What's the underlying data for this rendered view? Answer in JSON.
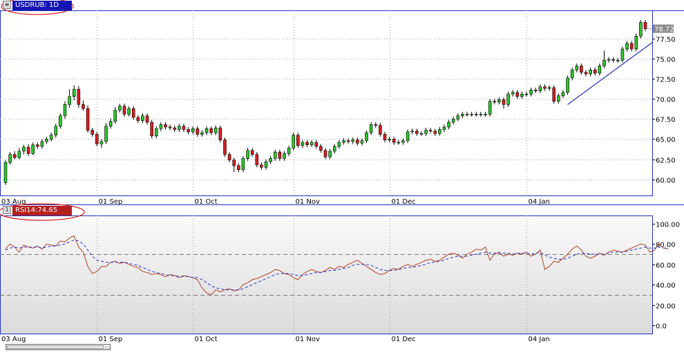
{
  "price_tag": "USDRUB: 1D",
  "rsi_tag": "RSI14:74.65",
  "last_price_label": "78.72",
  "price_y_ticks": [
    "60.00",
    "62.50",
    "65.00",
    "67.50",
    "70.00",
    "72.50",
    "75.00",
    "77.50"
  ],
  "rsi_y_ticks": [
    "0.0",
    "20.00",
    "40.00",
    "60.00",
    "80.00",
    "100.00"
  ],
  "x_ticks": [
    "03 Aug",
    "01 Sep",
    "01 Oct",
    "01 Nov",
    "01 Dec",
    "04 Jan"
  ],
  "colors": {
    "pane_border": "#1a2fbf",
    "grid": "#9a9a9a",
    "bull": "#2ec42e",
    "bear": "#d81e1e",
    "trendline": "#1a2fbf",
    "rsi": "#b04020",
    "rsi_avg": "#2233cc",
    "tag_price": "#1414b4",
    "tag_rsi": "#b42020",
    "last_price_bg": "#8a8a8a"
  },
  "chart_data": [
    {
      "type": "candlestick",
      "title": "USDRUB: 1D",
      "ylim": [
        58.0,
        81.0
      ],
      "x_tick_labels": [
        "03 Aug",
        "01 Sep",
        "01 Oct",
        "01 Nov",
        "01 Dec",
        "04 Jan"
      ],
      "last_value": 78.72,
      "candles": [
        [
          59.6,
          62.1,
          59.3,
          62.4
        ],
        [
          62.1,
          63.1,
          61.8,
          63.4
        ],
        [
          63.1,
          62.7,
          62.5,
          63.5
        ],
        [
          62.7,
          63.5,
          62.5,
          63.9
        ],
        [
          63.5,
          64.0,
          63.1,
          64.3
        ],
        [
          64.0,
          63.2,
          62.9,
          64.4
        ],
        [
          63.2,
          64.3,
          63.0,
          64.6
        ],
        [
          64.3,
          64.1,
          63.8,
          64.6
        ],
        [
          64.1,
          64.7,
          63.8,
          65.0
        ],
        [
          64.7,
          65.0,
          64.4,
          65.3
        ],
        [
          65.0,
          65.5,
          64.7,
          65.8
        ],
        [
          65.5,
          66.6,
          65.2,
          66.9
        ],
        [
          66.6,
          67.9,
          66.3,
          68.2
        ],
        [
          67.9,
          69.3,
          67.5,
          69.7
        ],
        [
          69.3,
          70.3,
          68.9,
          71.2
        ],
        [
          70.3,
          71.2,
          69.8,
          71.7
        ],
        [
          71.2,
          69.3,
          68.9,
          71.6
        ],
        [
          69.3,
          68.8,
          68.5,
          69.8
        ],
        [
          68.8,
          66.1,
          65.8,
          69.2
        ],
        [
          66.1,
          65.6,
          65.3,
          66.4
        ],
        [
          65.6,
          64.4,
          64.1,
          65.9
        ],
        [
          64.4,
          64.7,
          63.9,
          65.0
        ],
        [
          64.7,
          66.6,
          64.4,
          67.0
        ],
        [
          66.6,
          67.2,
          66.3,
          67.6
        ],
        [
          67.2,
          68.6,
          66.9,
          69.0
        ],
        [
          68.6,
          69.1,
          68.3,
          69.4
        ],
        [
          69.1,
          68.1,
          67.8,
          69.4
        ],
        [
          68.1,
          68.8,
          67.8,
          69.1
        ],
        [
          68.8,
          67.7,
          67.4,
          69.1
        ],
        [
          67.7,
          67.3,
          67.0,
          68.0
        ],
        [
          67.3,
          67.9,
          67.0,
          68.2
        ],
        [
          67.9,
          67.1,
          66.8,
          68.2
        ],
        [
          67.1,
          65.4,
          65.1,
          67.4
        ],
        [
          65.4,
          66.3,
          65.1,
          66.6
        ],
        [
          66.3,
          66.8,
          66.0,
          67.1
        ],
        [
          66.8,
          66.5,
          66.2,
          67.1
        ],
        [
          66.5,
          66.4,
          66.1,
          66.8
        ],
        [
          66.4,
          66.2,
          65.9,
          66.7
        ],
        [
          66.2,
          66.6,
          65.9,
          66.9
        ],
        [
          66.6,
          66.2,
          65.9,
          66.9
        ],
        [
          66.2,
          65.9,
          65.6,
          66.5
        ],
        [
          65.9,
          66.3,
          65.6,
          66.6
        ],
        [
          66.3,
          65.6,
          65.3,
          66.6
        ],
        [
          65.6,
          65.8,
          65.3,
          66.1
        ],
        [
          65.8,
          66.3,
          65.5,
          66.6
        ],
        [
          66.3,
          65.8,
          65.5,
          66.6
        ],
        [
          65.8,
          66.4,
          65.5,
          66.7
        ],
        [
          66.4,
          64.9,
          64.6,
          66.7
        ],
        [
          64.9,
          63.1,
          62.8,
          65.2
        ],
        [
          63.1,
          62.4,
          62.1,
          63.4
        ],
        [
          62.4,
          61.7,
          60.9,
          62.7
        ],
        [
          61.7,
          61.2,
          60.9,
          62.0
        ],
        [
          61.2,
          62.6,
          60.9,
          62.9
        ],
        [
          62.6,
          63.6,
          62.3,
          63.9
        ],
        [
          63.6,
          63.1,
          62.8,
          63.9
        ],
        [
          63.1,
          61.8,
          61.5,
          63.4
        ],
        [
          61.8,
          61.5,
          61.2,
          62.1
        ],
        [
          61.5,
          62.2,
          61.2,
          62.5
        ],
        [
          62.2,
          62.6,
          61.9,
          62.9
        ],
        [
          62.6,
          63.4,
          62.3,
          63.7
        ],
        [
          63.4,
          62.6,
          62.3,
          63.7
        ],
        [
          62.6,
          63.2,
          62.3,
          63.5
        ],
        [
          63.2,
          63.9,
          62.9,
          64.2
        ],
        [
          63.9,
          65.5,
          63.6,
          65.8
        ],
        [
          65.5,
          64.2,
          63.9,
          65.8
        ],
        [
          64.2,
          64.6,
          63.9,
          64.9
        ],
        [
          64.6,
          64.3,
          64.0,
          64.9
        ],
        [
          64.3,
          64.6,
          64.0,
          64.9
        ],
        [
          64.6,
          64.1,
          63.8,
          64.9
        ],
        [
          64.1,
          63.6,
          63.3,
          64.4
        ],
        [
          63.6,
          62.8,
          62.5,
          63.9
        ],
        [
          62.8,
          63.5,
          62.5,
          63.8
        ],
        [
          63.5,
          64.1,
          63.2,
          64.4
        ],
        [
          64.1,
          64.6,
          63.8,
          64.9
        ],
        [
          64.6,
          64.8,
          64.3,
          65.1
        ],
        [
          64.8,
          64.7,
          64.4,
          65.1
        ],
        [
          64.7,
          64.9,
          64.4,
          65.2
        ],
        [
          64.9,
          64.5,
          64.2,
          65.2
        ],
        [
          64.5,
          64.8,
          64.2,
          65.1
        ],
        [
          64.8,
          65.8,
          64.5,
          66.1
        ],
        [
          65.8,
          66.8,
          65.5,
          67.1
        ],
        [
          66.8,
          66.7,
          66.4,
          67.1
        ],
        [
          66.7,
          65.6,
          65.3,
          67.0
        ],
        [
          65.6,
          64.9,
          64.6,
          65.9
        ],
        [
          64.9,
          65.0,
          64.6,
          65.3
        ],
        [
          65.0,
          64.6,
          64.3,
          65.3
        ],
        [
          64.6,
          64.6,
          64.3,
          64.9
        ],
        [
          64.6,
          64.8,
          64.3,
          65.1
        ],
        [
          64.8,
          65.9,
          64.5,
          66.2
        ],
        [
          65.9,
          66.0,
          65.6,
          66.3
        ],
        [
          66.0,
          65.7,
          65.4,
          66.3
        ],
        [
          65.7,
          65.7,
          65.4,
          66.0
        ],
        [
          65.7,
          66.1,
          65.4,
          66.4
        ],
        [
          66.1,
          66.0,
          65.7,
          66.4
        ],
        [
          66.0,
          65.7,
          65.4,
          66.3
        ],
        [
          65.7,
          66.2,
          65.4,
          66.5
        ],
        [
          66.2,
          66.5,
          65.9,
          66.8
        ],
        [
          66.5,
          67.1,
          66.2,
          67.4
        ],
        [
          67.1,
          67.5,
          66.8,
          67.8
        ],
        [
          67.5,
          67.9,
          67.2,
          68.2
        ],
        [
          67.9,
          68.1,
          67.6,
          68.4
        ],
        [
          68.1,
          68.1,
          67.8,
          68.4
        ],
        [
          68.1,
          68.1,
          67.8,
          68.4
        ],
        [
          68.1,
          68.1,
          67.8,
          68.4
        ],
        [
          68.1,
          68.1,
          67.8,
          68.4
        ],
        [
          68.1,
          68.1,
          67.8,
          68.4
        ],
        [
          68.1,
          69.7,
          67.8,
          70.0
        ],
        [
          69.7,
          69.6,
          69.3,
          70.0
        ],
        [
          69.6,
          69.9,
          69.3,
          70.2
        ],
        [
          69.9,
          69.3,
          68.8,
          70.2
        ],
        [
          69.3,
          70.6,
          69.0,
          70.9
        ],
        [
          70.6,
          70.8,
          70.3,
          71.1
        ],
        [
          70.8,
          70.3,
          70.0,
          71.1
        ],
        [
          70.3,
          70.6,
          70.0,
          70.9
        ],
        [
          70.6,
          70.6,
          70.3,
          70.9
        ],
        [
          70.6,
          71.1,
          70.3,
          71.4
        ],
        [
          71.1,
          71.0,
          70.7,
          71.4
        ],
        [
          71.0,
          71.5,
          70.7,
          71.8
        ],
        [
          71.5,
          71.3,
          71.0,
          71.8
        ],
        [
          71.3,
          71.4,
          71.0,
          71.7
        ],
        [
          71.4,
          69.7,
          69.4,
          71.7
        ],
        [
          69.7,
          70.4,
          69.4,
          70.7
        ],
        [
          70.4,
          70.8,
          70.1,
          71.1
        ],
        [
          70.8,
          72.6,
          70.5,
          72.9
        ],
        [
          72.6,
          73.6,
          72.3,
          73.9
        ],
        [
          73.6,
          74.1,
          73.3,
          74.4
        ],
        [
          74.1,
          73.3,
          73.0,
          74.4
        ],
        [
          73.3,
          73.1,
          72.8,
          73.6
        ],
        [
          73.1,
          73.6,
          72.8,
          73.9
        ],
        [
          73.6,
          73.2,
          72.9,
          73.9
        ],
        [
          73.2,
          74.1,
          72.9,
          74.4
        ],
        [
          74.1,
          74.8,
          73.8,
          76.0
        ],
        [
          74.8,
          74.9,
          74.5,
          75.2
        ],
        [
          74.9,
          74.8,
          74.5,
          75.2
        ],
        [
          74.8,
          74.8,
          74.5,
          75.1
        ],
        [
          74.8,
          76.2,
          74.5,
          76.5
        ],
        [
          76.2,
          76.9,
          75.9,
          77.2
        ],
        [
          76.9,
          76.2,
          75.9,
          77.2
        ],
        [
          76.2,
          77.8,
          75.9,
          78.1
        ],
        [
          77.8,
          79.5,
          77.5,
          79.8
        ],
        [
          79.5,
          78.72,
          78.4,
          79.8
        ]
      ],
      "trendline": [
        [
          123,
          69.3
        ],
        [
          145,
          77.0
        ]
      ]
    },
    {
      "type": "line",
      "title": "RSI14:74.65",
      "ylim": [
        -8,
        108
      ],
      "y_tick_labels": [
        "0.0",
        "20.00",
        "40.00",
        "60.00",
        "80.00",
        "100.00"
      ],
      "reference_levels": [
        30,
        70
      ],
      "last_value": 74.65,
      "series": [
        {
          "name": "RSI14",
          "values": [
            75,
            80,
            77,
            72,
            79,
            77,
            76,
            78,
            75,
            80,
            79,
            78,
            83,
            82,
            86,
            88,
            77,
            72,
            58,
            51,
            53,
            58,
            58,
            62,
            63,
            61,
            62,
            60,
            58,
            57,
            53,
            52,
            50,
            51,
            50,
            48,
            50,
            49,
            47,
            49,
            48,
            47,
            45,
            37,
            32,
            30,
            35,
            33,
            35,
            36,
            34,
            35,
            40,
            42,
            45,
            46,
            48,
            50,
            52,
            55,
            54,
            51,
            50,
            47,
            45,
            50,
            53,
            55,
            53,
            52,
            54,
            57,
            55,
            58,
            57,
            60,
            62,
            64,
            61,
            58,
            55,
            52,
            50,
            51,
            54,
            56,
            55,
            58,
            60,
            58,
            60,
            62,
            64,
            65,
            63,
            64,
            67,
            70,
            71,
            69,
            66,
            70,
            72,
            75,
            74,
            77,
            64,
            70,
            72,
            68,
            70,
            69,
            71,
            70,
            72,
            68,
            70,
            74,
            55,
            58,
            63,
            62,
            66,
            70,
            75,
            78,
            74,
            68,
            66,
            68,
            71,
            69,
            72,
            74,
            73,
            72,
            74,
            76,
            78,
            80,
            79,
            72,
            74,
            80,
            76,
            75
          ]
        },
        {
          "name": "RSI14 average",
          "values": [
            74,
            76,
            77,
            76,
            77,
            77,
            77,
            77,
            76,
            77,
            78,
            78,
            79,
            80,
            82,
            84,
            83,
            80,
            74,
            68,
            64,
            63,
            62,
            62,
            62,
            62,
            62,
            61,
            60,
            59,
            57,
            55,
            53,
            52,
            51,
            50,
            49,
            49,
            48,
            48,
            48,
            47,
            47,
            45,
            42,
            39,
            37,
            36,
            35,
            35,
            35,
            35,
            36,
            38,
            40,
            42,
            44,
            46,
            48,
            50,
            51,
            51,
            51,
            50,
            49,
            49,
            50,
            51,
            52,
            52,
            53,
            54,
            54,
            55,
            56,
            57,
            59,
            60,
            60,
            60,
            59,
            57,
            55,
            54,
            54,
            54,
            55,
            56,
            57,
            57,
            58,
            59,
            60,
            62,
            62,
            63,
            64,
            66,
            67,
            68,
            68,
            68,
            69,
            70,
            71,
            72,
            71,
            71,
            71,
            71,
            71,
            70,
            71,
            71,
            71,
            70,
            71,
            72,
            69,
            67,
            66,
            65,
            65,
            66,
            68,
            70,
            71,
            71,
            70,
            70,
            70,
            70,
            71,
            72,
            72,
            72,
            73,
            74,
            75,
            76,
            77,
            76,
            76,
            77,
            76,
            76
          ]
        }
      ]
    }
  ]
}
